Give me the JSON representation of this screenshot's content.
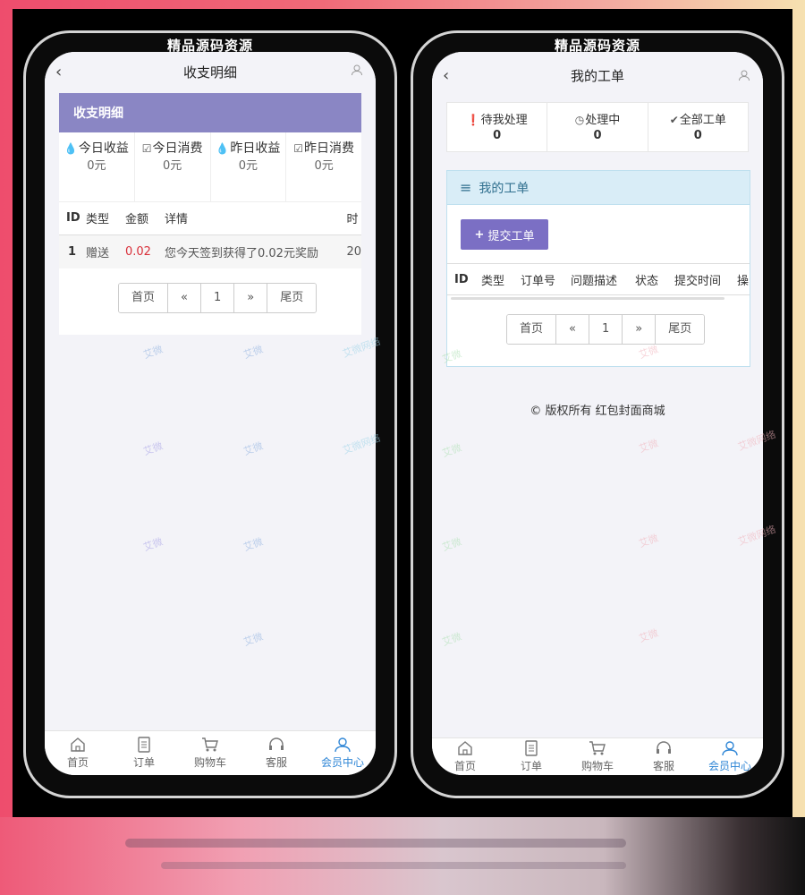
{
  "phone_label": "精品源码资源",
  "left": {
    "title": "收支明细",
    "section_title": "收支明细",
    "stats": [
      {
        "icon": "drop-icon",
        "label": "今日收益",
        "value": "0元"
      },
      {
        "icon": "check-icon",
        "label": "今日消费",
        "value": "0元"
      },
      {
        "icon": "drop-icon",
        "label": "昨日收益",
        "value": "0元"
      },
      {
        "icon": "check-icon",
        "label": "昨日消费",
        "value": "0元"
      }
    ],
    "table": {
      "headers": [
        "ID",
        "类型",
        "金额",
        "详情",
        "时"
      ],
      "rows": [
        {
          "id": "1",
          "type": "赠送",
          "amount": "0.02",
          "detail": "您今天签到获得了0.02元奖励",
          "time": "20"
        }
      ]
    },
    "pager": {
      "first": "首页",
      "prev": "«",
      "page": "1",
      "next": "»",
      "last": "尾页"
    }
  },
  "right": {
    "title": "我的工单",
    "stats": [
      {
        "icon": "exclamation-icon",
        "label": "待我处理",
        "value": "0"
      },
      {
        "icon": "clock-icon",
        "label": "处理中",
        "value": "0"
      },
      {
        "icon": "check-circle-icon",
        "label": "全部工单",
        "value": "0"
      }
    ],
    "panel_title": "我的工单",
    "submit_label": "提交工单",
    "table": {
      "headers": [
        "ID",
        "类型",
        "订单号",
        "问题描述",
        "状态",
        "提交时间",
        "操"
      ]
    },
    "pager": {
      "first": "首页",
      "prev": "«",
      "page": "1",
      "next": "»",
      "last": "尾页"
    },
    "footer": "© 版权所有 红包封面商城"
  },
  "tabbar": [
    {
      "icon": "home-icon",
      "label": "首页"
    },
    {
      "icon": "order-icon",
      "label": "订单"
    },
    {
      "icon": "cart-icon",
      "label": "购物车"
    },
    {
      "icon": "headset-icon",
      "label": "客服"
    },
    {
      "icon": "user-icon",
      "label": "会员中心"
    }
  ],
  "watermarks": [
    "艾微",
    "艾微网络"
  ],
  "colors": {
    "accent": "#7b6fc4",
    "purple_header": "#8a86c4",
    "active_tab": "#2f86d6",
    "amount_red": "#d9303a",
    "panel_blue": "#d9edf7"
  }
}
